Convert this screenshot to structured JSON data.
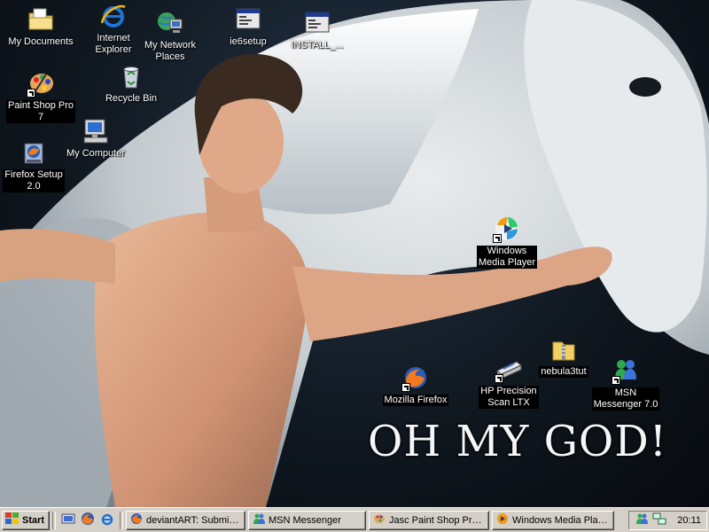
{
  "wallpaper": {
    "slogan": "OH MY GOD!"
  },
  "desktop_icons": [
    {
      "key": "my-documents",
      "label": "My Documents",
      "icon": "folder-documents-icon",
      "shortcut": false
    },
    {
      "key": "internet-explorer",
      "label": "Internet\nExplorer",
      "icon": "internet-explorer-icon",
      "shortcut": false
    },
    {
      "key": "my-network-places",
      "label": "My Network\nPlaces",
      "icon": "network-places-icon",
      "shortcut": false
    },
    {
      "key": "ie6setup",
      "label": "ie6setup",
      "icon": "installer-window-icon",
      "shortcut": false
    },
    {
      "key": "install",
      "label": "INSTALL_...",
      "icon": "installer-window-icon",
      "shortcut": false
    },
    {
      "key": "paint-shop-pro",
      "label": "Paint Shop Pro\n7",
      "icon": "palette-icon",
      "shortcut": true
    },
    {
      "key": "recycle-bin",
      "label": "Recycle Bin",
      "icon": "recycle-bin-icon",
      "shortcut": false
    },
    {
      "key": "my-computer",
      "label": "My Computer",
      "icon": "computer-icon",
      "shortcut": false
    },
    {
      "key": "firefox-setup",
      "label": "Firefox Setup\n2.0",
      "icon": "firefox-setup-icon",
      "shortcut": false
    },
    {
      "key": "windows-media-player",
      "label": "Windows\nMedia Player",
      "icon": "media-player-icon",
      "shortcut": true
    },
    {
      "key": "nebula3tut",
      "label": "nebula3tut",
      "icon": "zip-folder-icon",
      "shortcut": false
    },
    {
      "key": "mozilla-firefox",
      "label": "Mozilla Firefox",
      "icon": "firefox-icon",
      "shortcut": true
    },
    {
      "key": "hp-precision-scan",
      "label": "HP Precision\nScan LTX",
      "icon": "scanner-icon",
      "shortcut": true
    },
    {
      "key": "msn-messenger",
      "label": "MSN\nMessenger 7.0",
      "icon": "msn-messenger-icon",
      "shortcut": true
    }
  ],
  "taskbar": {
    "start_label": "Start",
    "quick_launch": [
      "show-desktop-icon",
      "firefox-icon",
      "internet-explorer-icon"
    ],
    "tasks": [
      {
        "label": "deviantART: Submiss...",
        "icon": "firefox-icon"
      },
      {
        "label": "MSN Messenger",
        "icon": "msn-messenger-icon"
      },
      {
        "label": "Jasc Paint Shop Pro -...",
        "icon": "palette-icon"
      },
      {
        "label": "Windows Media Player",
        "icon": "media-player-icon"
      }
    ],
    "tray": {
      "icons": [
        "msn-tray-icon",
        "network-tray-icon"
      ],
      "clock": "20:11"
    }
  }
}
